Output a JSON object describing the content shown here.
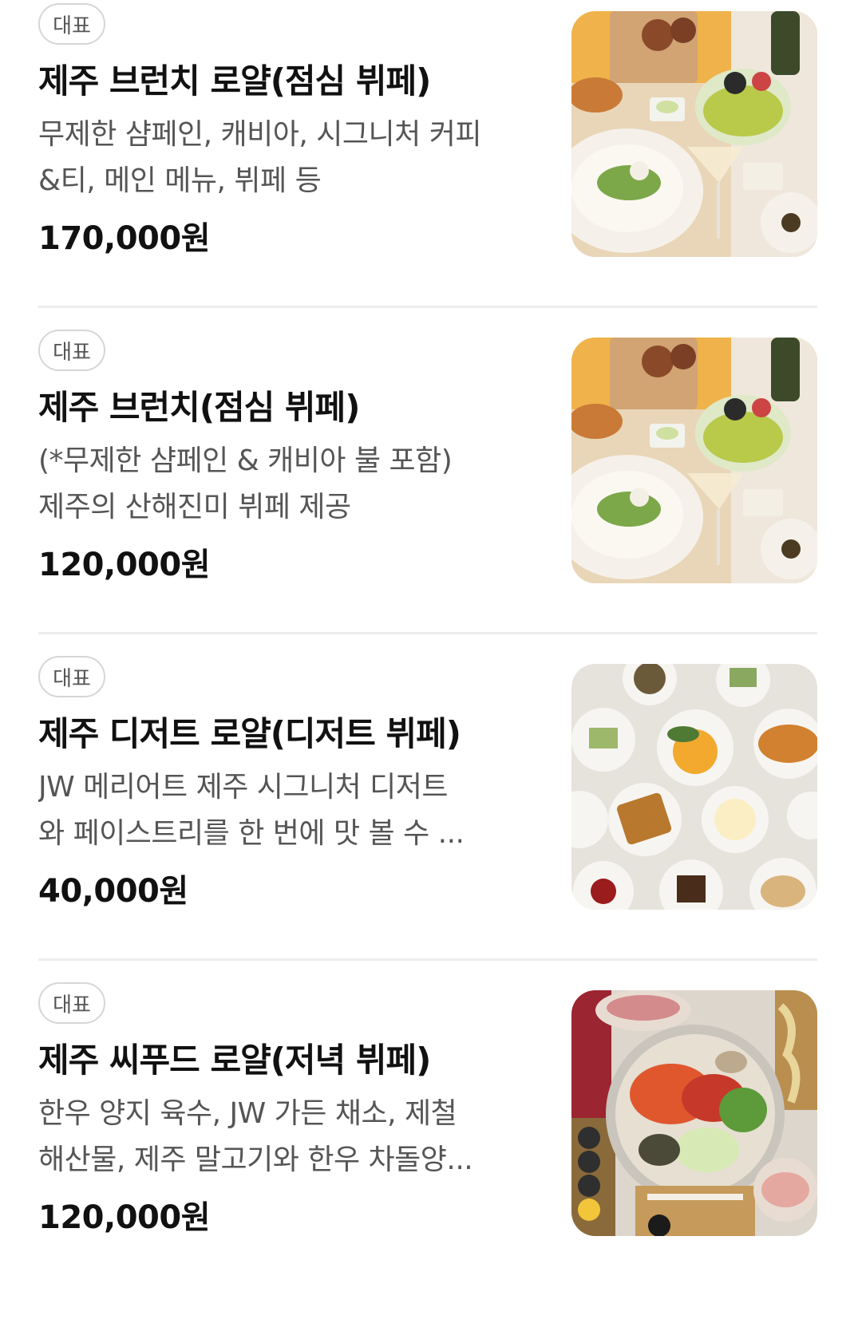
{
  "menu_items": [
    {
      "badge": "대표",
      "title": "제주 브런치 로얄(점심 뷔페)",
      "desc_lines": [
        "무제한 샴페인, 캐비아, 시그니처 커피",
        "&티, 메인 메뉴, 뷔페 등"
      ],
      "price": "170,000원",
      "image_label": "brunch buffet photo"
    },
    {
      "badge": "대표",
      "title": "제주 브런치(점심 뷔페)",
      "desc_lines": [
        "(*무제한 샴페인 & 캐비아 불 포함)",
        "제주의 산해진미 뷔페 제공"
      ],
      "price": "120,000원",
      "image_label": "brunch buffet photo"
    },
    {
      "badge": "대표",
      "title": "제주 디저트 로얄(디저트 뷔페)",
      "desc_lines": [
        "JW 메리어트 제주 시그니처 디저트",
        "와 페이스트리를 한 번에 맛 볼 수 ..."
      ],
      "price": "40,000원",
      "image_label": "dessert buffet photo"
    },
    {
      "badge": "대표",
      "title": "제주 씨푸드 로얄(저녁 뷔페)",
      "desc_lines": [
        "한우 양지 육수, JW 가든 채소, 제철",
        "해산물, 제주 말고기와 한우 차돌양..."
      ],
      "price": "120,000원",
      "image_label": "seafood dinner photo"
    }
  ],
  "colors": {
    "title": "#111111",
    "description": "#555555",
    "badge_border": "#d6d6d6",
    "divider": "#ededed"
  }
}
